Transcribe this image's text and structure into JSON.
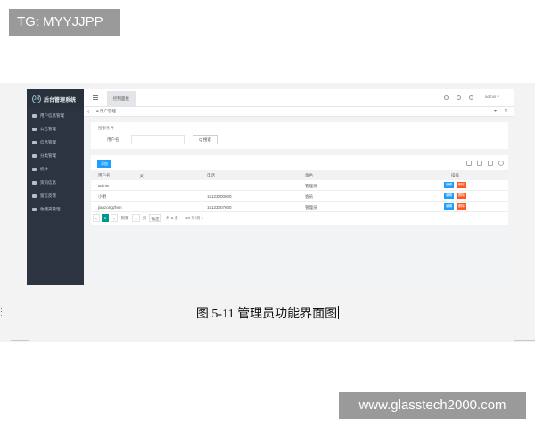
{
  "overlay": {
    "top_tag": "TG: MYYJJPP",
    "bottom_tag": "www.glasstech2000.com"
  },
  "screenshot": {
    "brand": {
      "logo": "JN",
      "title": "后台管理系统"
    },
    "sidebar": {
      "items": [
        {
          "label": "用户信息管理",
          "icon": "list-icon"
        },
        {
          "label": "公告管理",
          "icon": "list-icon"
        },
        {
          "label": "信息管理",
          "icon": "list-icon"
        },
        {
          "label": "分类管理",
          "icon": "list-icon"
        },
        {
          "label": "统计",
          "icon": "file-icon"
        },
        {
          "label": "资讯信息",
          "icon": "file-icon"
        },
        {
          "label": "留言反馈",
          "icon": "file-icon"
        },
        {
          "label": "收藏夹管理",
          "icon": "file-icon"
        }
      ]
    },
    "topbar": {
      "tab": "控制面板",
      "user": "admin ▾"
    },
    "breadcrumb": {
      "text": "■ 用户管理",
      "back": "‹",
      "ctrl_down": "▾",
      "ctrl_close": "✕"
    },
    "search": {
      "legend": "搜索条件",
      "label": "用户名",
      "button": "Q 搜索"
    },
    "table": {
      "add_button": "添加",
      "headers": [
        "用户名",
        "电话",
        "角色",
        "操作"
      ],
      "rows": [
        [
          "admin",
          "",
          "管理员"
        ],
        [
          "小明",
          "15123000000",
          "会员"
        ],
        [
          "jiaozongzhen",
          "15123007000",
          "管理员"
        ]
      ],
      "edit_label": "编辑",
      "delete_label": "删除"
    },
    "pager": {
      "prev": "‹",
      "current": "1",
      "next": "›",
      "goto": "到第",
      "page_input": "1",
      "page_unit": "页",
      "confirm": "确定",
      "total": "共 3 条",
      "per_page": "10 条/页 ▾"
    }
  },
  "caption": "图 5-11 管理员功能界面图"
}
